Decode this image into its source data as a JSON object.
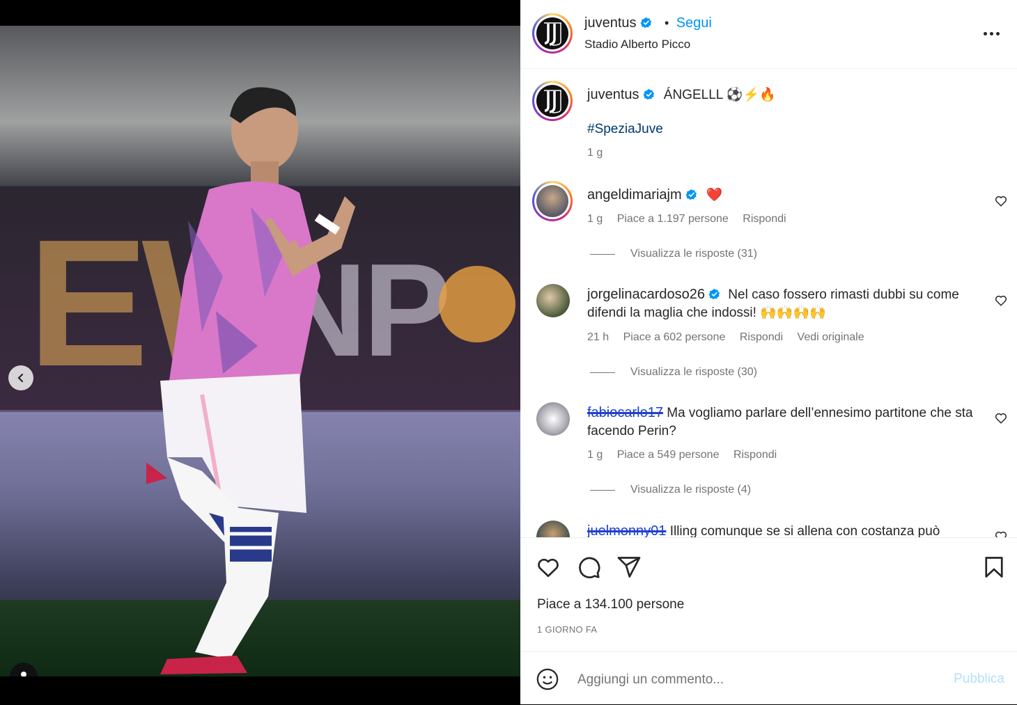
{
  "post": {
    "username": "juventus",
    "follow_label": "Segui",
    "separator": "•",
    "location": "Stadio Alberto Picco",
    "caption_user": "juventus",
    "caption_text": "ÁNGELLL ⚽⚡🔥",
    "hashtag": "#SpeziaJuve",
    "caption_time": "1 g"
  },
  "comments": [
    {
      "user": "angeldimariajm",
      "text": "❤️",
      "time": "1 g",
      "likes": "Piace a 1.197 persone",
      "reply": "Rispondi",
      "view_replies": "Visualizza le risposte (31)"
    },
    {
      "user": "jorgelinacardoso26",
      "text": "Nel caso fossero rimasti dubbi su come difendi la maglia che indossi! 🙌🙌🙌🙌",
      "time": "21 h",
      "likes": "Piace a 602 persone",
      "reply": "Rispondi",
      "original": "Vedi originale",
      "view_replies": "Visualizza le risposte (30)"
    },
    {
      "user": "fabiocarlo17",
      "text": "Ma vogliamo parlare dell’ennesimo partitone che sta facendo Perin?",
      "time": "1 g",
      "likes": "Piace a 549 persone",
      "reply": "Rispondi",
      "view_replies": "Visualizza le risposte (4)"
    },
    {
      "user": "juelmonny01",
      "text": "Illing comunque se si allena con costanza può"
    }
  ],
  "footer": {
    "likes": "Piace a 134.100 persone",
    "time": "1 GIORNO FA",
    "comment_placeholder": "Aggiungi un commento...",
    "publish": "Pubblica"
  },
  "media": {
    "slides": 2,
    "current": 2
  },
  "icons": {
    "verified": "verified-badge-icon",
    "more": "more-options-icon",
    "like": "heart-icon",
    "comment": "comment-icon",
    "share": "send-icon",
    "save": "bookmark-icon",
    "emoji": "emoji-icon",
    "prev": "chevron-left-icon",
    "user_tag": "user-tag-icon"
  },
  "colors": {
    "accent": "#0095f6",
    "verified": "#0095f6",
    "hashtag": "#00376b",
    "muted": "#737373",
    "publish_disabled": "#b2dffc"
  }
}
